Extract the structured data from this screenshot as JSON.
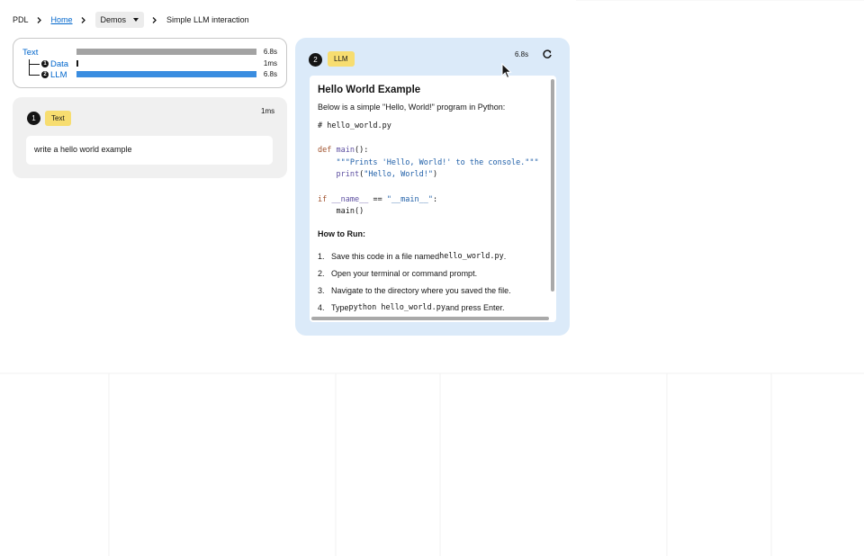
{
  "breadcrumb": {
    "root": "PDL",
    "home": "Home",
    "demos": "Demos",
    "current": "Simple LLM interaction"
  },
  "timeline": {
    "rows": [
      {
        "label": "Text",
        "duration": "6.8s",
        "fraction": 1.0,
        "color": "#a3a3a3"
      },
      {
        "num": "1",
        "label": "Data",
        "duration": "1ms",
        "fraction": 0.01,
        "color": "#151515"
      },
      {
        "num": "2",
        "label": "LLM",
        "duration": "6.8s",
        "fraction": 1.0,
        "color": "#3a8de0"
      }
    ]
  },
  "text_block": {
    "num": "1",
    "kind": "Text",
    "duration": "1ms",
    "input": "write a hello world example"
  },
  "llm_block": {
    "num": "2",
    "kind": "LLM",
    "duration": "6.8s",
    "refresh_icon": "refresh-icon",
    "output": {
      "title": "Hello World Example",
      "intro": "Below is a simple \"Hello, World!\" program in Python:",
      "code": {
        "comment": "# hello_world.py",
        "def_kw": "def",
        "fn_name": "main",
        "fn_suffix": "():",
        "docstring": "\"\"\"Prints 'Hello, World!' to the console.\"\"\"",
        "print_fn": "print",
        "print_arg_open": "(",
        "print_str": "\"Hello, World!\"",
        "print_arg_close": ")",
        "if_kw": "if",
        "name_var": "__name__",
        "eq": " == ",
        "main_str": "\"__main__\"",
        "colon": ":",
        "call": "main()"
      },
      "how_to": "How to Run:",
      "steps": [
        {
          "n": "1.",
          "before": "Save this code in a file named ",
          "code": "hello_world.py",
          "after": "."
        },
        {
          "n": "2.",
          "before": "Open your terminal or command prompt.",
          "code": "",
          "after": ""
        },
        {
          "n": "3.",
          "before": "Navigate to the directory where you saved the file.",
          "code": "",
          "after": ""
        },
        {
          "n": "4.",
          "before": "Type ",
          "code": "python hello_world.py",
          "after": " and press Enter."
        }
      ]
    }
  },
  "colors": {
    "badge": "#f7dd70",
    "llm_bg": "#dbeaf9",
    "link": "#0066cc"
  }
}
